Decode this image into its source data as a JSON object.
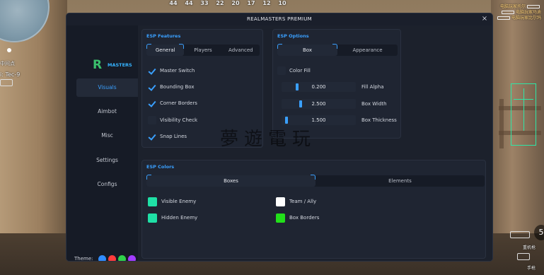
{
  "hud": {
    "top_numbers": [
      "44",
      "44",
      "33",
      "22",
      "20",
      "17",
      "12",
      "10"
    ],
    "weapon_label": "Tec-9",
    "location_label": "中间点",
    "killfeed": [
      {
        "text": "电脑玩家托尔"
      },
      {
        "text": "电脑玩家马迪"
      },
      {
        "text": "电脑玩家比尔玛"
      }
    ],
    "right_score": "5",
    "right_weapon_label": "重机枪",
    "right_weapon_label2": "手枪"
  },
  "window": {
    "title": "REALMASTERS PREMIUM",
    "close_glyph": "×"
  },
  "sidebar": {
    "logo_mark": "R",
    "logo_text": "MASTERS",
    "items": [
      {
        "label": "Visuals",
        "active": true
      },
      {
        "label": "Aimbot",
        "active": false
      },
      {
        "label": "Misc",
        "active": false
      },
      {
        "label": "Settings",
        "active": false
      },
      {
        "label": "Configs",
        "active": false
      }
    ],
    "theme_label": "Theme:",
    "theme_colors": [
      "#2f8cff",
      "#ff3b3b",
      "#2fd24a",
      "#a23cff"
    ]
  },
  "esp_features": {
    "title": "ESP Features",
    "tabs": [
      "General",
      "Players",
      "Advanced"
    ],
    "active_tab": 0,
    "options": [
      {
        "label": "Master Switch",
        "checked": true
      },
      {
        "label": "Bounding Box",
        "checked": true
      },
      {
        "label": "Corner Borders",
        "checked": true
      },
      {
        "label": "Visibility Check",
        "checked": false
      },
      {
        "label": "Snap Lines",
        "checked": true
      }
    ]
  },
  "esp_options": {
    "title": "ESP Options",
    "tabs": [
      "Box",
      "Appearance"
    ],
    "active_tab": 0,
    "color_fill": {
      "label": "Color Fill",
      "checked": false
    },
    "sliders": [
      {
        "value": "0.200",
        "label": "Fill Alpha",
        "fraction": 0.2
      },
      {
        "value": "2.500",
        "label": "Box Width",
        "fraction": 0.25
      },
      {
        "value": "1.500",
        "label": "Box Thickness",
        "fraction": 0.05
      }
    ]
  },
  "esp_colors": {
    "title": "ESP Colors",
    "tabs": [
      "Boxes",
      "Elements"
    ],
    "active_tab": 0,
    "colors": [
      {
        "label": "Visible Enemy",
        "color": "#1fe0a6"
      },
      {
        "label": "Team / Ally",
        "color": "#ffffff"
      },
      {
        "label": "Hidden Enemy",
        "color": "#1fe0a6"
      },
      {
        "label": "Box Borders",
        "color": "#22e01a"
      }
    ]
  },
  "watermark": "夢遊電玩"
}
